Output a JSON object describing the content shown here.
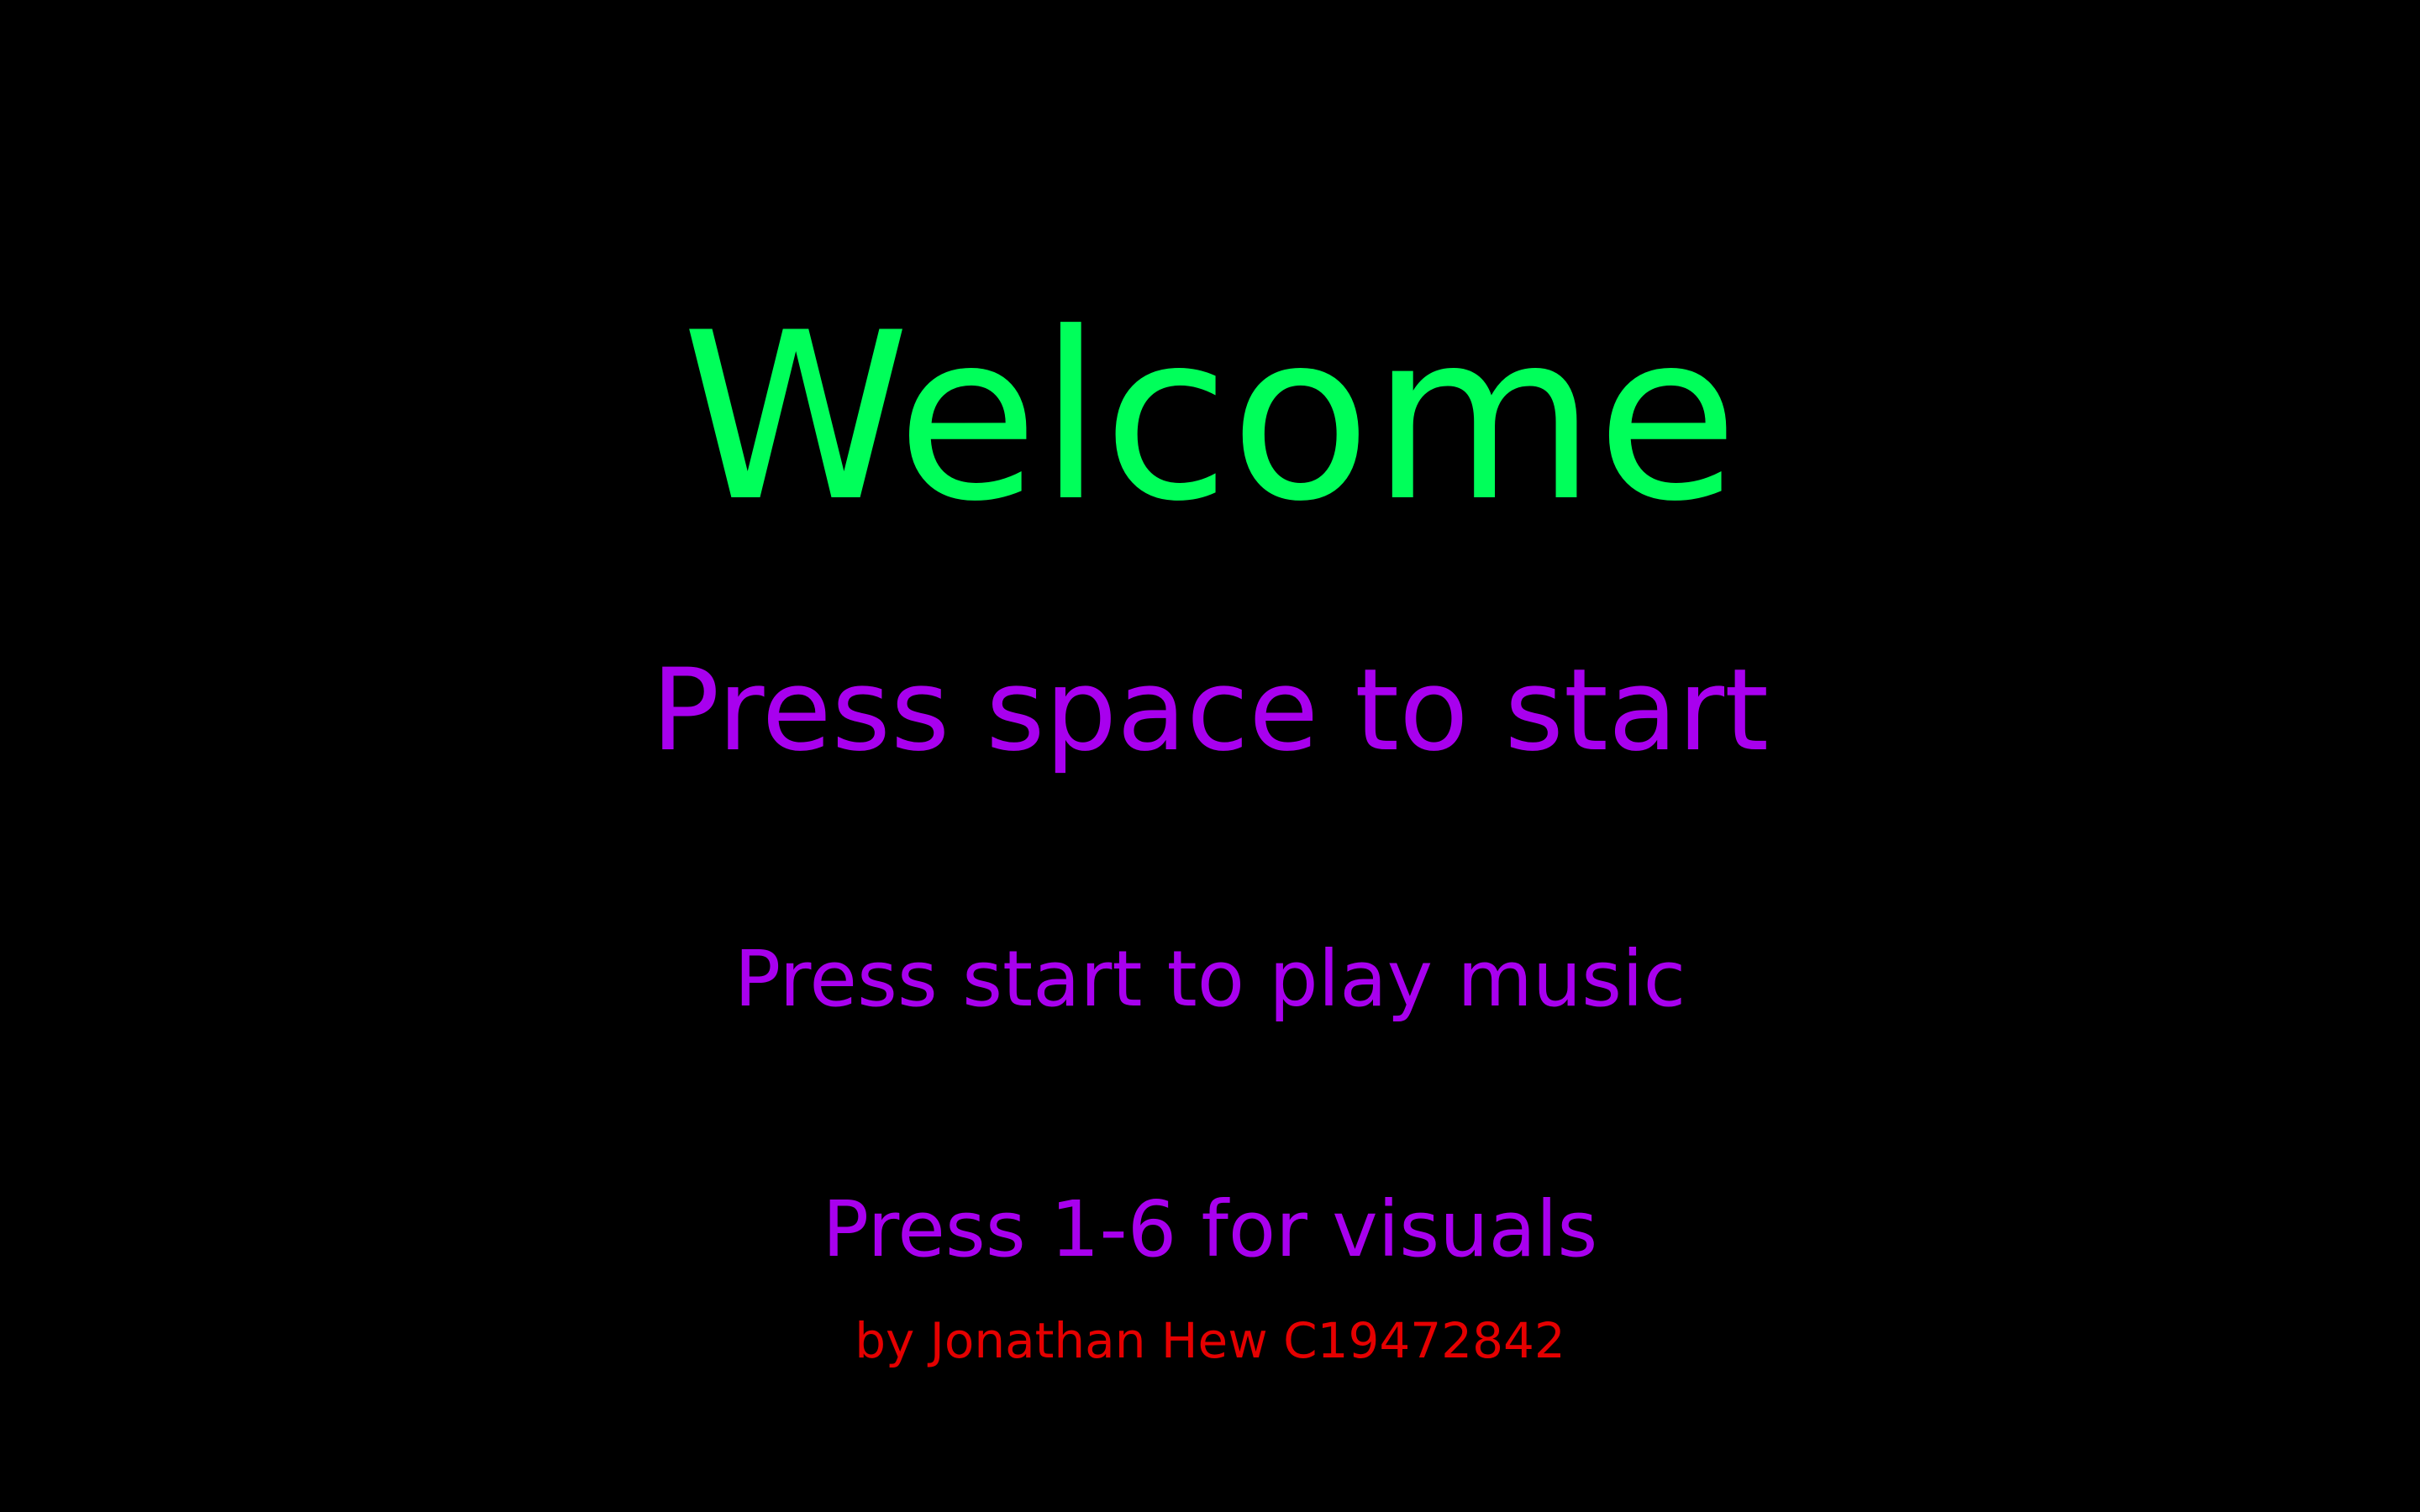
{
  "screen": {
    "title": "Welcome",
    "prompt_start": "Press space to start",
    "prompt_music": "Press start to play music",
    "prompt_visuals": "Press 1-6 for visuals",
    "credit": "by Jonathan Hew C19472842"
  },
  "colors": {
    "background": "#000000",
    "title": "#00ff5a",
    "prompts": "#a800ee",
    "credit": "#e50000"
  }
}
